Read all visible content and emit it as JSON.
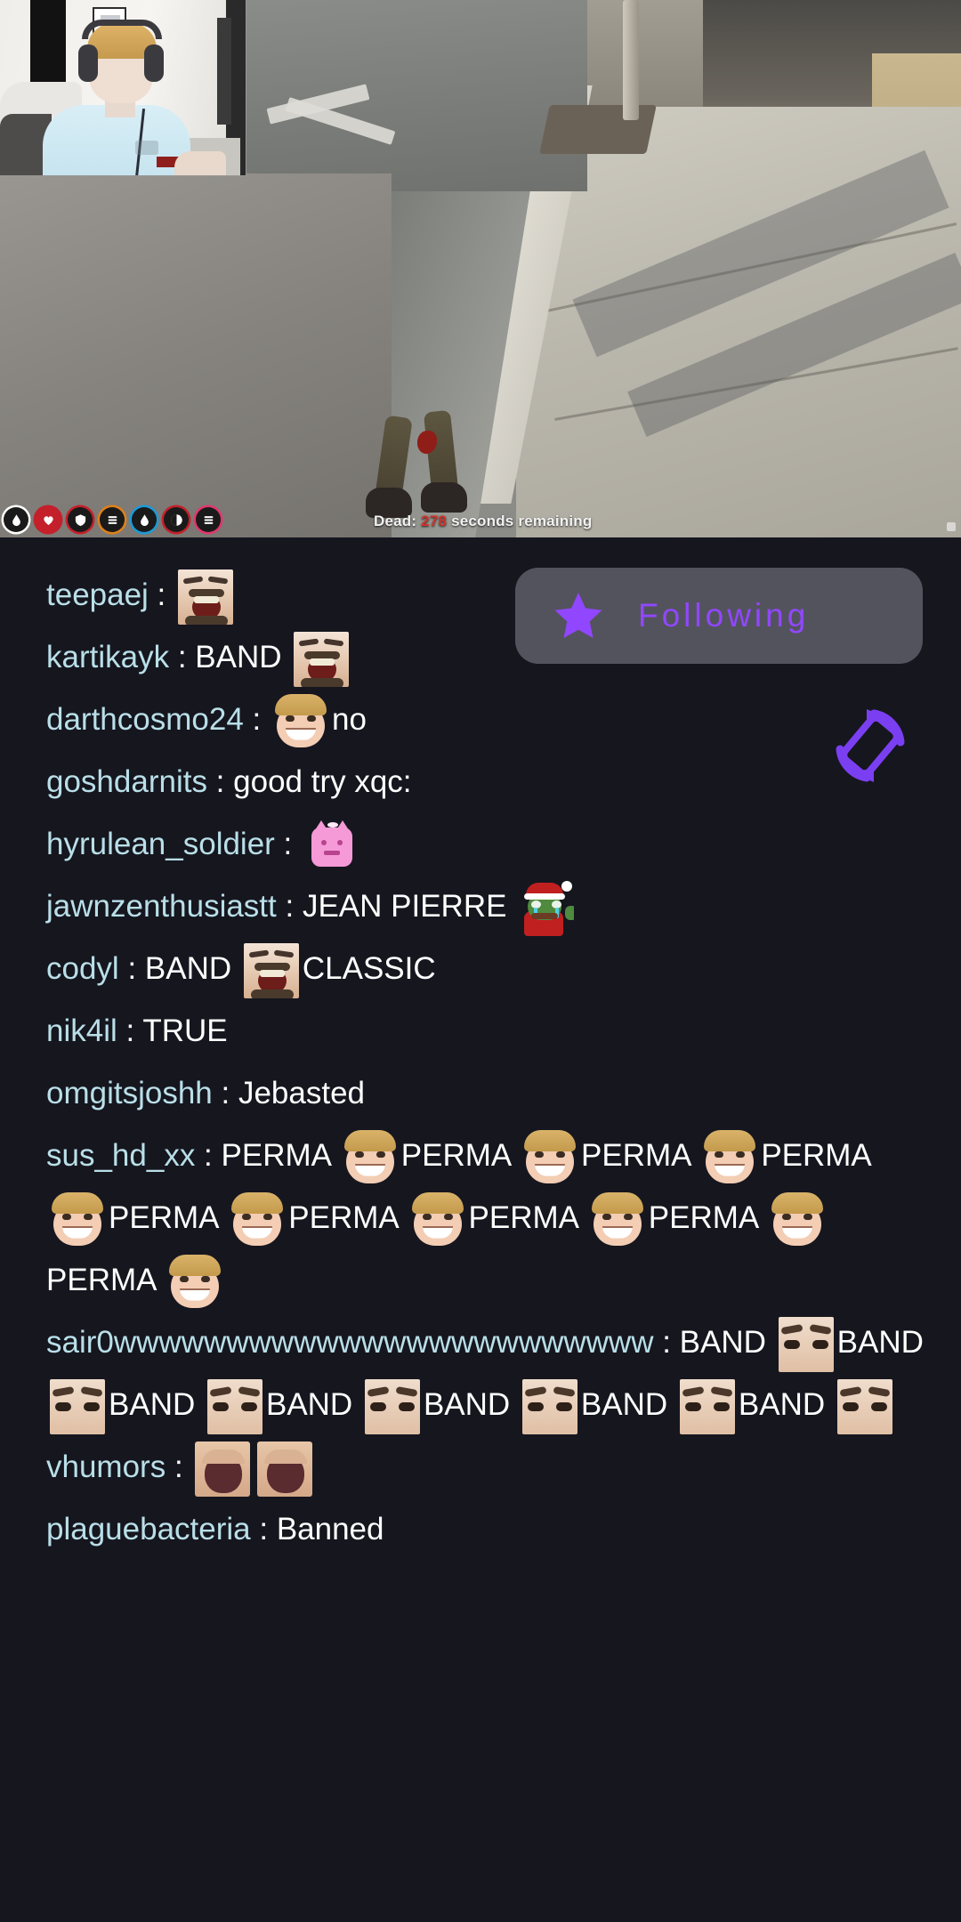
{
  "player": {
    "status_prefix": "Dead:",
    "status_seconds": "278",
    "status_suffix": "seconds remaining",
    "badges": [
      {
        "name": "prime-badge",
        "ring": "#ffffff",
        "fill": "#1a1a1a",
        "glyph": "drop"
      },
      {
        "name": "heart-badge",
        "ring": "#c4202b",
        "fill": "#c4202b",
        "glyph": "heart"
      },
      {
        "name": "shield-badge",
        "ring": "#c4202b",
        "fill": "#1a1a1a",
        "glyph": "shield"
      },
      {
        "name": "burger-badge",
        "ring": "#e0801a",
        "fill": "#1a1a1a",
        "glyph": "bars"
      },
      {
        "name": "water-badge",
        "ring": "#1b9bd8",
        "fill": "#1a1a1a",
        "glyph": "drop"
      },
      {
        "name": "moon-badge",
        "ring": "#c4202b",
        "fill": "#1a1a1a",
        "glyph": "half"
      },
      {
        "name": "menu-badge",
        "ring": "#e0366f",
        "fill": "#1a1a1a",
        "glyph": "bars"
      }
    ]
  },
  "overlay": {
    "follow_label": "Following",
    "follow_icon": "star-icon",
    "rotate_icon": "screen-rotate-icon",
    "accent_color": "#9147ff"
  },
  "chat": {
    "username_color": "#b9dfe8",
    "text_color": "#ffffff",
    "background": "#16161f",
    "messages": [
      {
        "user": "teepaej",
        "parts": [
          {
            "type": "emote",
            "emote": "laugh"
          }
        ]
      },
      {
        "user": "kartikayk",
        "parts": [
          {
            "type": "text",
            "value": "BAND"
          },
          {
            "type": "emote",
            "emote": "laugh"
          }
        ]
      },
      {
        "user": "darthcosmo24",
        "parts": [
          {
            "type": "emote",
            "emote": "blonde"
          },
          {
            "type": "text",
            "value": "no"
          }
        ]
      },
      {
        "user": "goshdarnits",
        "parts": [
          {
            "type": "text",
            "value": "good try xqc:"
          }
        ]
      },
      {
        "user": "hyrulean_soldier",
        "parts": [
          {
            "type": "emote",
            "emote": "pig"
          }
        ]
      },
      {
        "user": "jawnzenthusiastt",
        "parts": [
          {
            "type": "text",
            "value": "JEAN PIERRE"
          },
          {
            "type": "emote",
            "emote": "santafrog"
          }
        ]
      },
      {
        "user": "codyl",
        "parts": [
          {
            "type": "text",
            "value": "BAND"
          },
          {
            "type": "emote",
            "emote": "laugh"
          },
          {
            "type": "text",
            "value": "CLASSIC"
          }
        ]
      },
      {
        "user": "nik4il",
        "parts": [
          {
            "type": "text",
            "value": "TRUE"
          }
        ]
      },
      {
        "user": "omgitsjoshh",
        "parts": [
          {
            "type": "text",
            "value": "Jebasted"
          }
        ]
      },
      {
        "user": "sus_hd_xx",
        "parts": [
          {
            "type": "text",
            "value": "PERMA"
          },
          {
            "type": "emote",
            "emote": "blonde"
          },
          {
            "type": "text",
            "value": "PERMA"
          },
          {
            "type": "emote",
            "emote": "blonde"
          },
          {
            "type": "text",
            "value": "PERMA"
          },
          {
            "type": "emote",
            "emote": "blonde"
          },
          {
            "type": "text",
            "value": "PERMA"
          },
          {
            "type": "emote",
            "emote": "blonde"
          },
          {
            "type": "text",
            "value": "PERMA"
          },
          {
            "type": "emote",
            "emote": "blonde"
          },
          {
            "type": "text",
            "value": "PERMA"
          },
          {
            "type": "emote",
            "emote": "blonde"
          },
          {
            "type": "text",
            "value": "PERMA"
          },
          {
            "type": "emote",
            "emote": "blonde"
          },
          {
            "type": "text",
            "value": "PERMA"
          },
          {
            "type": "emote",
            "emote": "blonde"
          },
          {
            "type": "text",
            "value": "PERMA"
          },
          {
            "type": "emote",
            "emote": "blonde"
          }
        ]
      },
      {
        "user": "sair0wwwwwwwwwwwwwwwwwwwwwwww",
        "parts": [
          {
            "type": "text",
            "value": "BAND"
          },
          {
            "type": "emote",
            "emote": "eyes"
          },
          {
            "type": "text",
            "value": "BAND"
          },
          {
            "type": "emote",
            "emote": "eyes"
          },
          {
            "type": "text",
            "value": "BAND"
          },
          {
            "type": "emote",
            "emote": "eyes"
          },
          {
            "type": "text",
            "value": "BAND"
          },
          {
            "type": "emote",
            "emote": "eyes"
          },
          {
            "type": "text",
            "value": "BAND"
          },
          {
            "type": "emote",
            "emote": "eyes"
          },
          {
            "type": "text",
            "value": "BAND"
          },
          {
            "type": "emote",
            "emote": "eyes"
          },
          {
            "type": "text",
            "value": "BAND"
          },
          {
            "type": "emote",
            "emote": "eyes"
          }
        ]
      },
      {
        "user": "vhumors",
        "parts": [
          {
            "type": "emote",
            "emote": "mouth"
          },
          {
            "type": "emote",
            "emote": "mouth"
          }
        ]
      },
      {
        "user": "plaguebacteria",
        "parts": [
          {
            "type": "text",
            "value": "Banned"
          }
        ]
      }
    ]
  }
}
